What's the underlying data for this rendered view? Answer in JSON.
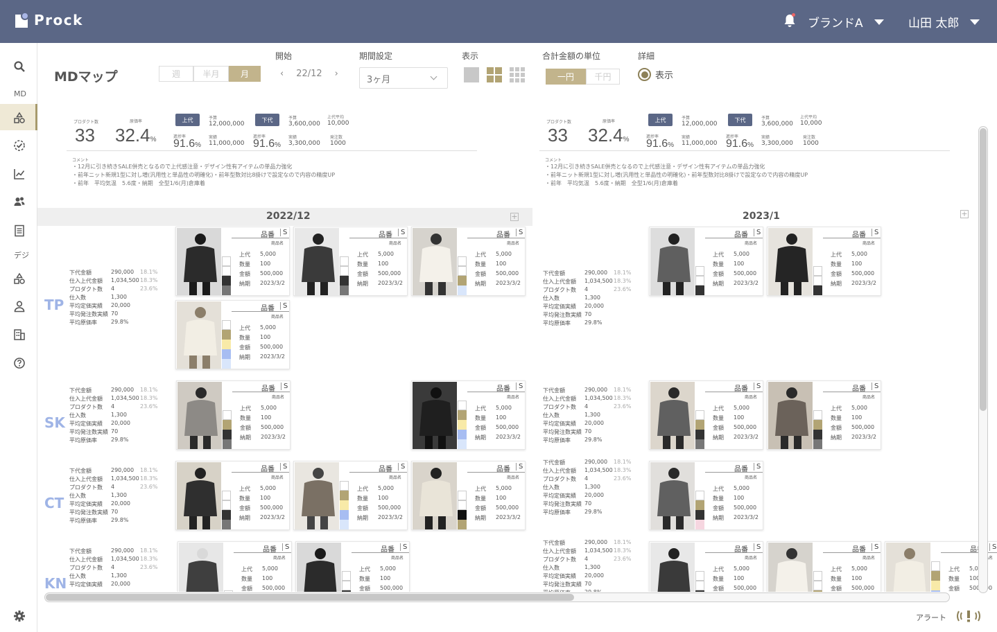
{
  "header": {
    "logo": "Prock",
    "brand": "ブランドA",
    "user": "山田 太郎"
  },
  "sidebar": {
    "md_label": "MD",
    "de_label": "デジ"
  },
  "title": "MDマップ",
  "period": {
    "options": [
      "週",
      "半月",
      "月"
    ],
    "selected": "月"
  },
  "start": {
    "label": "開始",
    "value": "22/12",
    "prev": "‹",
    "next": "›"
  },
  "period_setting": {
    "label": "期間設定",
    "value": "3ヶ月"
  },
  "display": {
    "label": "表示"
  },
  "unit": {
    "label": "合計金額の単位",
    "options": [
      "一円",
      "千円"
    ],
    "selected": "一円"
  },
  "detail": {
    "label": "詳細",
    "radio": "表示"
  },
  "summary": {
    "product_count_label": "プロダクト数",
    "product_count": "33",
    "rate_label": "原価率",
    "rate": "32.4",
    "rate_unit": "%",
    "upper_btn": "上代",
    "lower_btn": "下代",
    "budget_label": "予算",
    "actual_label": "実績",
    "progress_label": "進捗率",
    "avg_label": "上代平均",
    "order_label": "発注数",
    "upper_budget": "12,000,000",
    "upper_actual": "11,000,000",
    "upper_progress": "91.6",
    "lower_budget": "3,600,000",
    "lower_actual": "3,300,000",
    "lower_progress": "91.6",
    "avg": "10,000",
    "orders": "1000",
    "comment_label": "コメント",
    "comments": [
      "・12月に引き続きSALE併売となるので上代感注意・デザイン性有アイテムの単品力強化",
      "・前年ニット新規1型に対し増(汎用性と単品性の明確化)・前年型数対比8掛けで設定なので内容の精度UP",
      "・前年　平均気温　5.6度・納期　全型1/6(月)倉庫着"
    ]
  },
  "months": [
    "2022/12",
    "2023/1"
  ],
  "categories": [
    "TP",
    "SK",
    "CT",
    "KN"
  ],
  "stat_labels": [
    "下代金額",
    "仕入上代金額",
    "プロダクト数",
    "仕入数",
    "平均定価実績",
    "平均発注数実績",
    "平均原価率"
  ],
  "stat_values": [
    "290,000",
    "1,034,500",
    "4",
    "1,300",
    "20,000",
    "70",
    "29.8%"
  ],
  "stat_pcts": [
    "18.1%",
    "18.3%",
    "23.6%"
  ],
  "card": {
    "hinban": "品番",
    "size": "S",
    "name": "商品名",
    "k1": "上代",
    "v1": "5,000",
    "k2": "数量",
    "v2": "100",
    "k3": "金額",
    "v3": "500,000",
    "k4": "納期",
    "v4": "2023/3/2"
  },
  "footer": {
    "alert": "アラート"
  },
  "colors": {
    "header": "#5b6786",
    "accent": "#c2b48c",
    "category": "#9fb4e6"
  }
}
